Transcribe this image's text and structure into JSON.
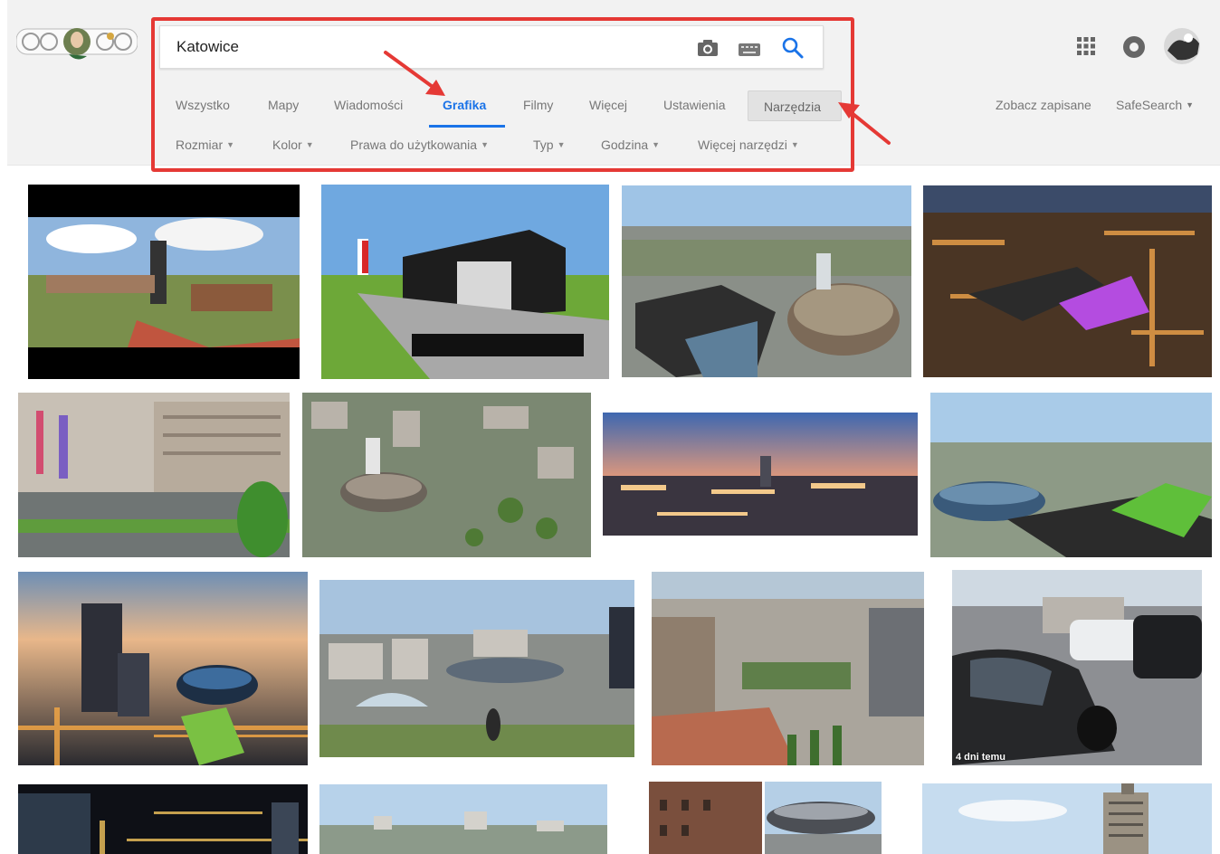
{
  "search": {
    "query": "Katowice"
  },
  "tabs": [
    {
      "label": "Wszystko",
      "active": false
    },
    {
      "label": "Mapy",
      "active": false
    },
    {
      "label": "Wiadomości",
      "active": false
    },
    {
      "label": "Grafika",
      "active": true
    },
    {
      "label": "Filmy",
      "active": false
    },
    {
      "label": "Więcej",
      "active": false
    },
    {
      "label": "Ustawienia",
      "active": false
    },
    {
      "label": "Narzędzia",
      "active": false
    }
  ],
  "filters": [
    {
      "label": "Rozmiar"
    },
    {
      "label": "Kolor"
    },
    {
      "label": "Prawa do użytkowania"
    },
    {
      "label": "Typ"
    },
    {
      "label": "Godzina"
    },
    {
      "label": "Więcej narzędzi"
    }
  ],
  "right": {
    "saved_label": "Zobacz zapisane",
    "safesearch_label": "SafeSearch"
  },
  "icons": {
    "camera": "camera-icon",
    "keyboard": "keyboard-icon",
    "search": "search-icon",
    "apps": "apps-grid-icon",
    "notifications": "notifications-icon",
    "account": "account-avatar"
  },
  "colors": {
    "accent": "#1a73e8",
    "highlight": "#e53935",
    "header_bg": "#f2f2f2"
  },
  "results": [
    {
      "badge": ""
    },
    {
      "badge": ""
    },
    {
      "badge": ""
    },
    {
      "badge": ""
    },
    {
      "badge": ""
    },
    {
      "badge": ""
    },
    {
      "badge": ""
    },
    {
      "badge": ""
    },
    {
      "badge": ""
    },
    {
      "badge": ""
    },
    {
      "badge": ""
    },
    {
      "badge": "4 dni temu"
    },
    {
      "badge": ""
    },
    {
      "badge": ""
    },
    {
      "badge": ""
    },
    {
      "badge": ""
    }
  ]
}
